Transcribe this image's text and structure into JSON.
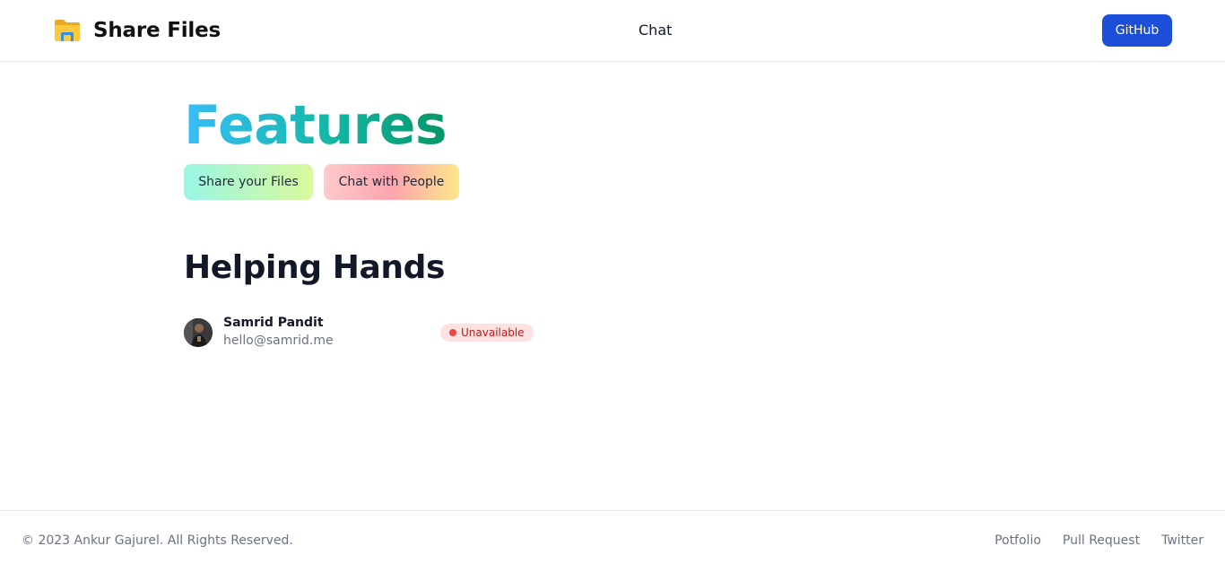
{
  "header": {
    "brand_title": "Share Files",
    "brand_icon": "folder-icon",
    "nav_chat": "Chat",
    "github_label": "GitHub"
  },
  "colors": {
    "github_button": "#1d4ed8",
    "features_gradient": [
      "#38bdf8",
      "#14b8a6",
      "#059669"
    ],
    "status_unavailable": "#ef4444"
  },
  "features": {
    "title": "Features",
    "items": [
      {
        "label": "Share your Files"
      },
      {
        "label": "Chat with People"
      }
    ]
  },
  "helping_hands": {
    "title": "Helping Hands",
    "people": [
      {
        "name": "Samrid Pandit",
        "email": "hello@samrid.me",
        "status": "Unavailable"
      }
    ]
  },
  "footer": {
    "copyright": "© 2023 Ankur Gajurel. All Rights Reserved.",
    "links": [
      {
        "label": "Potfolio"
      },
      {
        "label": "Pull Request"
      },
      {
        "label": "Twitter"
      }
    ]
  }
}
